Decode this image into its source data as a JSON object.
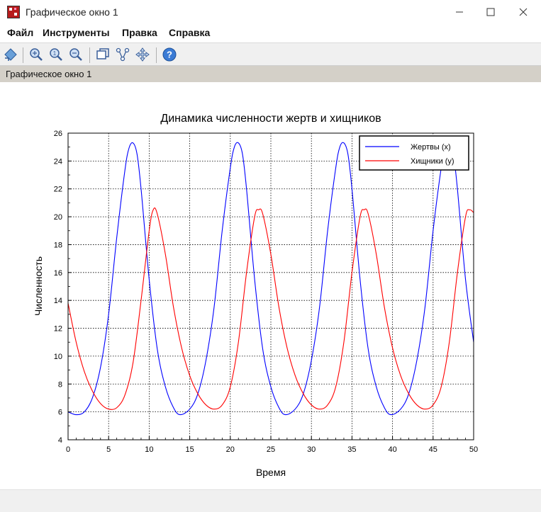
{
  "window": {
    "title": "Графическое окно 1",
    "minimize_icon": "minimize-icon",
    "maximize_icon": "maximize-icon",
    "close_icon": "close-icon"
  },
  "menu": [
    {
      "label": "Файл"
    },
    {
      "label": "Инструменты"
    },
    {
      "label": "Правка"
    },
    {
      "label": "Справка"
    }
  ],
  "toolbar": {
    "icons": [
      "rotate-icon",
      "zoom-in-icon",
      "zoom-reset-icon",
      "zoom-out-icon",
      "datatip-icon",
      "graph-editor-icon",
      "pan-icon",
      "help-icon"
    ]
  },
  "status": {
    "text": "Графическое окно 1"
  },
  "colors": {
    "prey": "#0000ff",
    "predator": "#ff0000",
    "grid": "#000000"
  },
  "chart_data": {
    "type": "line",
    "title": "Динамика численности жертв и хищников",
    "xlabel": "Время",
    "ylabel": "Численность",
    "xlim": [
      0,
      50
    ],
    "ylim": [
      4,
      26
    ],
    "xticks": [
      0,
      5,
      10,
      15,
      20,
      25,
      30,
      35,
      40,
      45,
      50
    ],
    "yticks": [
      4,
      6,
      8,
      10,
      12,
      14,
      16,
      18,
      20,
      22,
      24,
      26
    ],
    "grid": true,
    "legend_position": "top-right",
    "series": [
      {
        "name": "Жертвы (x)",
        "color": "#0000ff",
        "x": [
          0,
          1,
          2,
          3,
          4,
          5,
          6,
          7,
          7.5,
          8,
          8.5,
          9,
          10,
          11,
          12,
          13,
          13.8,
          15,
          16,
          17,
          18,
          19,
          20,
          20.5,
          21,
          21.5,
          22,
          23,
          24,
          25,
          26,
          26.8,
          28,
          29,
          30,
          31,
          32,
          33,
          33.5,
          34,
          34.5,
          35,
          36,
          37,
          38,
          39,
          39.8,
          41,
          42,
          43,
          44,
          45,
          46,
          46.5,
          47,
          47.5,
          48,
          49,
          50
        ],
        "y": [
          6.0,
          5.8,
          6.0,
          7.0,
          9.2,
          13.0,
          18.5,
          23.3,
          24.9,
          25.3,
          24.5,
          22.0,
          15.5,
          10.5,
          7.8,
          6.3,
          5.8,
          6.2,
          7.3,
          9.7,
          13.5,
          19.0,
          23.5,
          25.0,
          25.3,
          24.5,
          22.0,
          15.5,
          10.5,
          7.8,
          6.3,
          5.8,
          6.2,
          7.3,
          9.7,
          13.5,
          19.0,
          23.5,
          25.0,
          25.3,
          24.5,
          22.0,
          15.5,
          10.5,
          7.8,
          6.3,
          5.8,
          6.2,
          7.3,
          9.7,
          13.5,
          19.0,
          23.5,
          25.0,
          25.3,
          24.5,
          22.0,
          15.5,
          11.0
        ]
      },
      {
        "name": "Хищники (у)",
        "color": "#ff0000",
        "x": [
          0,
          1,
          2,
          3,
          4,
          5,
          6,
          7,
          8,
          9,
          10,
          10.5,
          11,
          12,
          13,
          14,
          15,
          16,
          17,
          18,
          19,
          20,
          21,
          22,
          23,
          23.5,
          24,
          25,
          26,
          27,
          28,
          29,
          30,
          31,
          32,
          33,
          34,
          35,
          36,
          36.5,
          37,
          38,
          39,
          40,
          41,
          42,
          43,
          44,
          45,
          46,
          47,
          48,
          49,
          49.5,
          50
        ],
        "y": [
          13.8,
          11.0,
          8.9,
          7.5,
          6.6,
          6.2,
          6.3,
          7.2,
          9.5,
          14.0,
          19.0,
          20.5,
          20.2,
          17.3,
          13.5,
          10.6,
          8.6,
          7.3,
          6.5,
          6.2,
          6.5,
          7.8,
          11.0,
          16.0,
          20.0,
          20.5,
          20.2,
          17.3,
          13.5,
          10.6,
          8.6,
          7.3,
          6.5,
          6.2,
          6.5,
          7.8,
          11.0,
          16.0,
          20.0,
          20.5,
          20.2,
          17.3,
          13.5,
          10.6,
          8.6,
          7.3,
          6.5,
          6.2,
          6.5,
          7.8,
          11.0,
          16.0,
          20.0,
          20.5,
          20.3
        ]
      }
    ]
  }
}
